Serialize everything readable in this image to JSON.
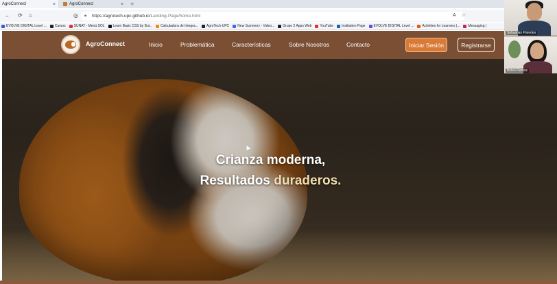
{
  "browser": {
    "tabs": [
      {
        "title": "AgroConnect"
      },
      {
        "title": "AgroConnect"
      }
    ],
    "url": {
      "host": "https://agrotech-upc.github.io",
      "path": "/Landing-Page/home.html"
    },
    "bookmarks": [
      {
        "label": "EVOLVE DIGITAL Level ...",
        "color": "#3b5bdb"
      },
      {
        "label": "Cursos",
        "color": "#222222"
      },
      {
        "label": "SUNAT - Menú SOL",
        "color": "#e03131"
      },
      {
        "label": "Learn Basic CSS by Bui...",
        "color": "#111111"
      },
      {
        "label": "Calculadora de Integra...",
        "color": "#f08c00"
      },
      {
        "label": "AgroTech-UPC",
        "color": "#222222"
      },
      {
        "label": "New Summery - Video...",
        "color": "#4263eb"
      },
      {
        "label": "Grupo 2 Apps Web",
        "color": "#222222"
      },
      {
        "label": "YouTube",
        "color": "#e03131"
      },
      {
        "label": "Institution Page",
        "color": "#1864ab"
      },
      {
        "label": "EVOLVE DIGITAL Level ...",
        "color": "#7048e8"
      },
      {
        "label": "Activities for Learners |...",
        "color": "#e8590c"
      },
      {
        "label": "Messaging |",
        "color": "#c2255c"
      }
    ]
  },
  "site": {
    "brand": "AgroConnect",
    "nav": [
      "Inicio",
      "Problemática",
      "Características",
      "Sobre Nosotros",
      "Contacto"
    ],
    "login_label": "Iniciar Sesión",
    "signup_label": "Registrarse",
    "headline_line1": "Crianza moderna,",
    "headline_line2_prefix": "Resultados ",
    "headline_line2_accent": "duraderos.",
    "colors": {
      "navbar": "#7a4f33",
      "login": "#d97a37",
      "accent_text": "#f3ddb0"
    }
  },
  "video_call": {
    "participants": [
      {
        "name": "Sebastian Paredes"
      },
      {
        "name": "Belen Ramos"
      }
    ]
  }
}
